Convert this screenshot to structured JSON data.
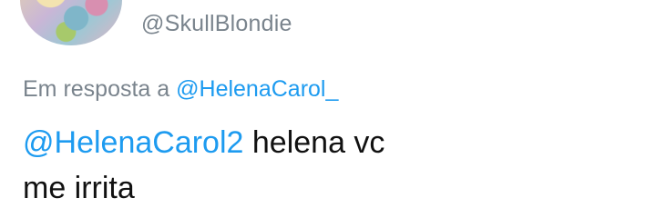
{
  "tweet": {
    "handle": "@SkullBlondie",
    "reply_prefix": "Em resposta a",
    "reply_to": "@HelenaCarol_",
    "mention": "@HelenaCarol2",
    "text_line1": "helena vc",
    "text_line2": "me irrita"
  }
}
